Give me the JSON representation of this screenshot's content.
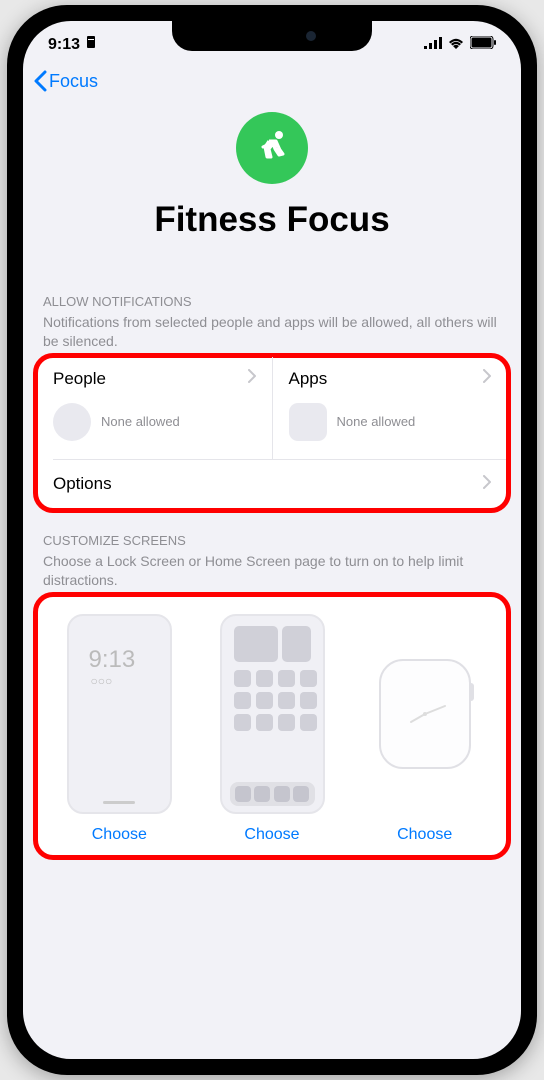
{
  "status": {
    "time": "9:13",
    "signal": "signal-icon"
  },
  "nav": {
    "back_label": "Focus"
  },
  "header": {
    "title": "Fitness Focus"
  },
  "notifications_section": {
    "title": "ALLOW NOTIFICATIONS",
    "description": "Notifications from selected people and apps will be allowed, all others will be silenced.",
    "people": {
      "label": "People",
      "status": "None allowed"
    },
    "apps": {
      "label": "Apps",
      "status": "None allowed"
    },
    "options": {
      "label": "Options"
    }
  },
  "screens_section": {
    "title": "CUSTOMIZE SCREENS",
    "description": "Choose a Lock Screen or Home Screen page to turn on to help limit distractions.",
    "lock": {
      "time": "9:13",
      "dots": "○○○",
      "button": "Choose"
    },
    "home": {
      "button": "Choose"
    },
    "watch": {
      "button": "Choose"
    }
  }
}
